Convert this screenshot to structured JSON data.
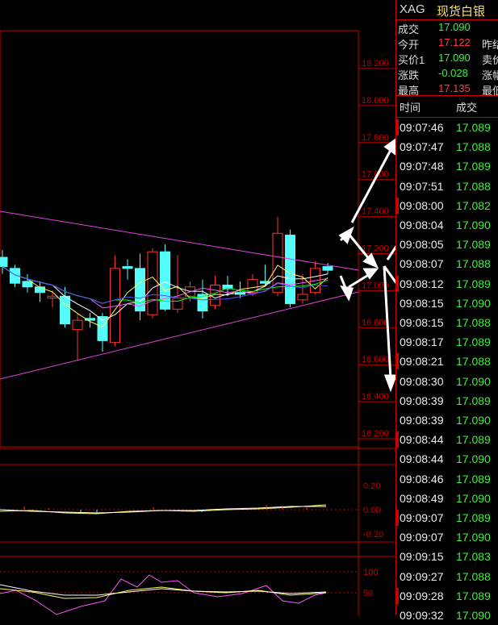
{
  "header": {
    "symbol": "XAG",
    "name": "现货白银"
  },
  "quote": [
    {
      "label": "成交",
      "value": "17.090",
      "color": "green",
      "label2": ""
    },
    {
      "label": "今开",
      "value": "17.122",
      "color": "red",
      "label2": "昨结"
    },
    {
      "label": "买价1",
      "value": "17.090",
      "color": "green",
      "label2": "卖价"
    },
    {
      "label": "涨跌",
      "value": "-0.028",
      "color": "green",
      "label2": "涨幅"
    },
    {
      "label": "最高",
      "value": "17.135",
      "color": "red",
      "label2": "最低"
    }
  ],
  "table_header": {
    "time": "时间",
    "trade": "成交"
  },
  "ticks": [
    {
      "time": "09:07:46",
      "price": "17.089"
    },
    {
      "time": "09:07:47",
      "price": "17.088"
    },
    {
      "time": "09:07:48",
      "price": "17.089"
    },
    {
      "time": "09:07:51",
      "price": "17.088"
    },
    {
      "time": "09:08:00",
      "price": "17.082"
    },
    {
      "time": "09:08:04",
      "price": "17.090"
    },
    {
      "time": "09:08:05",
      "price": "17.089"
    },
    {
      "time": "09:08:07",
      "price": "17.088"
    },
    {
      "time": "09:08:12",
      "price": "17.089"
    },
    {
      "time": "09:08:15",
      "price": "17.090"
    },
    {
      "time": "09:08:15",
      "price": "17.088"
    },
    {
      "time": "09:08:17",
      "price": "17.089"
    },
    {
      "time": "09:08:21",
      "price": "17.088"
    },
    {
      "time": "09:08:30",
      "price": "17.090"
    },
    {
      "time": "09:08:39",
      "price": "17.089"
    },
    {
      "time": "09:08:39",
      "price": "17.090"
    },
    {
      "time": "09:08:44",
      "price": "17.089"
    },
    {
      "time": "09:08:44",
      "price": "17.090"
    },
    {
      "time": "09:08:46",
      "price": "17.089"
    },
    {
      "time": "09:08:49",
      "price": "17.090"
    },
    {
      "time": "09:09:07",
      "price": "17.089"
    },
    {
      "time": "09:09:07",
      "price": "17.090"
    },
    {
      "time": "09:09:15",
      "price": "17.083"
    },
    {
      "time": "09:09:27",
      "price": "17.088"
    },
    {
      "time": "09:09:28",
      "price": "17.089"
    },
    {
      "time": "09:09:32",
      "price": "17.090"
    }
  ],
  "chart_data": {
    "type": "candlestick",
    "price_axis": [
      "18.200",
      "18.000",
      "17.800",
      "17.600",
      "17.400",
      "17.200",
      "17.000",
      "16.800",
      "16.600",
      "16.400",
      "16.200"
    ],
    "price_range": [
      16.2,
      18.2
    ],
    "macd_axis": [
      "0.20",
      "0.00",
      "-0.20"
    ],
    "kdj_axis": [
      "100",
      "50"
    ],
    "candles": [
      {
        "o": 17.18,
        "c": 17.13,
        "h": 17.22,
        "l": 17.09
      },
      {
        "o": 17.12,
        "c": 17.04,
        "h": 17.14,
        "l": 17.02
      },
      {
        "o": 17.05,
        "c": 17.02,
        "h": 17.09,
        "l": 16.99
      },
      {
        "o": 17.02,
        "c": 16.99,
        "h": 17.05,
        "l": 16.94
      },
      {
        "o": 16.96,
        "c": 16.97,
        "h": 17.0,
        "l": 16.91
      },
      {
        "o": 16.97,
        "c": 16.82,
        "h": 17.02,
        "l": 16.8
      },
      {
        "o": 16.79,
        "c": 16.84,
        "h": 16.88,
        "l": 16.62
      },
      {
        "o": 16.85,
        "c": 16.84,
        "h": 16.88,
        "l": 16.8
      },
      {
        "o": 16.86,
        "c": 16.73,
        "h": 16.88,
        "l": 16.67
      },
      {
        "o": 16.72,
        "c": 17.12,
        "h": 17.19,
        "l": 16.7
      },
      {
        "o": 17.13,
        "c": 17.12,
        "h": 17.17,
        "l": 17.06
      },
      {
        "o": 17.12,
        "c": 16.89,
        "h": 17.2,
        "l": 16.84
      },
      {
        "o": 16.87,
        "c": 17.21,
        "h": 17.23,
        "l": 16.85
      },
      {
        "o": 17.21,
        "c": 16.9,
        "h": 17.25,
        "l": 16.89
      },
      {
        "o": 16.9,
        "c": 16.96,
        "h": 17.19,
        "l": 16.88
      },
      {
        "o": 16.97,
        "c": 17.02,
        "h": 17.05,
        "l": 16.94
      },
      {
        "o": 16.98,
        "c": 16.89,
        "h": 17.06,
        "l": 16.85
      },
      {
        "o": 16.92,
        "c": 17.03,
        "h": 17.08,
        "l": 16.9
      },
      {
        "o": 17.03,
        "c": 17.01,
        "h": 17.08,
        "l": 16.97
      },
      {
        "o": 16.99,
        "c": 16.98,
        "h": 17.05,
        "l": 16.96
      },
      {
        "o": 16.99,
        "c": 17.06,
        "h": 17.09,
        "l": 16.97
      },
      {
        "o": 17.05,
        "c": 17.04,
        "h": 17.14,
        "l": 17.03
      },
      {
        "o": 16.99,
        "c": 17.31,
        "h": 17.4,
        "l": 16.97
      },
      {
        "o": 17.3,
        "c": 16.93,
        "h": 17.33,
        "l": 16.91
      },
      {
        "o": 16.95,
        "c": 16.98,
        "h": 17.09,
        "l": 16.93
      },
      {
        "o": 16.99,
        "c": 17.12,
        "h": 17.16,
        "l": 16.98
      },
      {
        "o": 17.13,
        "c": 17.11,
        "h": 17.15,
        "l": 17.09
      }
    ]
  },
  "colors": {
    "up": "#ff3232",
    "down": "#54fcfc",
    "grid": "#c00000",
    "ma1": "#ffffff",
    "ma2": "#ffff54",
    "ma3": "#ff54ff",
    "ma4": "#00ff00",
    "ma5": "#5050ff",
    "trend": "#e040e0"
  }
}
